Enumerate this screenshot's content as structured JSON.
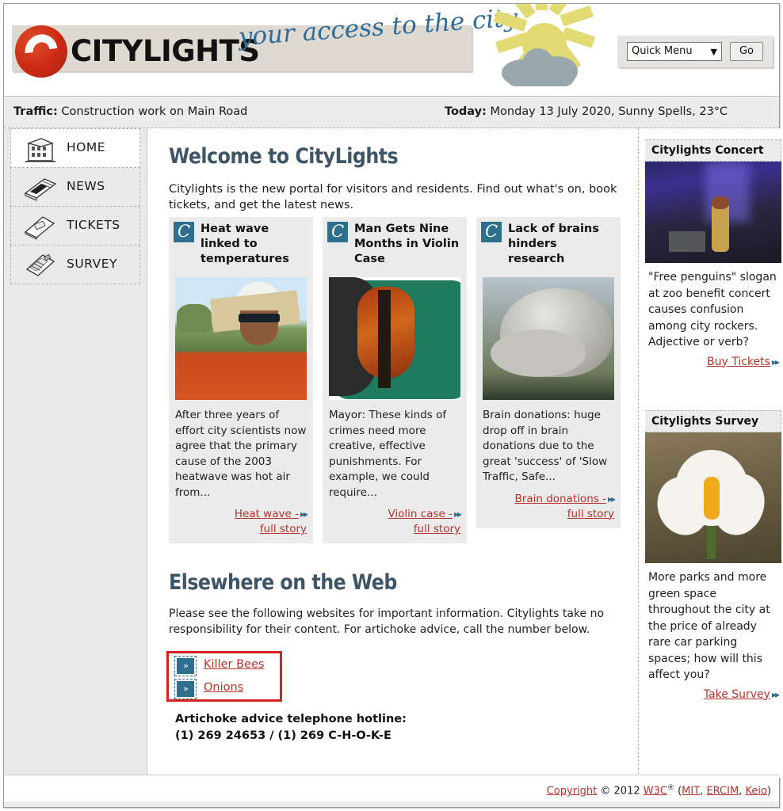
{
  "header": {
    "brand": "CITYLIGHTS",
    "tagline": "your access to the city",
    "quick_menu_value": "Quick Menu",
    "go_label": "Go",
    "logo_icon": "citylights-c-logo",
    "weather_icon": "sun-behind-cloud-icon"
  },
  "traffic_bar": {
    "traffic_label": "Traffic:",
    "traffic_text": "Construction work on Main Road",
    "today_label": "Today:",
    "today_text": "Monday 13 July 2020, Sunny Spells, 23°C"
  },
  "sidebar": {
    "items": [
      {
        "label": "HOME",
        "icon": "building-icon",
        "active": true
      },
      {
        "label": "NEWS",
        "icon": "newspaper-icon",
        "active": false
      },
      {
        "label": "TICKETS",
        "icon": "ticket-icon",
        "active": false
      },
      {
        "label": "SURVEY",
        "icon": "clipboard-icon",
        "active": false
      }
    ]
  },
  "main": {
    "welcome_title": "Welcome to CityLights",
    "intro": "Citylights is the new portal for visitors and residents. Find out what's on, book tickets, and get the latest news.",
    "cards": [
      {
        "badge": "C",
        "title": "Heat wave linked to temperatures",
        "image_alt": "man-wearing-cardboard-sun-hat-photo",
        "text": "After three years of effort city scientists now agree that the primary cause of the 2003 heatwave was hot air from...",
        "link_line1": "Heat wave -",
        "link_line2": "full story"
      },
      {
        "badge": "C",
        "title": "Man Gets Nine Months in Violin Case",
        "image_alt": "violin-in-green-case-photo",
        "text": "Mayor: These kinds of crimes need more creative, effective punishments. For example, we could require...",
        "link_line1": "Violin case -",
        "link_line2": "full story"
      },
      {
        "badge": "C",
        "title": "Lack of brains hinders research",
        "image_alt": "model-of-human-brain-photo",
        "text": "Brain donations: huge drop off in brain donations due to the great 'success' of 'Slow Traffic, Safe...",
        "link_line1": "Brain donations -",
        "link_line2": "full story"
      }
    ],
    "elsewhere_title": "Elsewhere on the Web",
    "elsewhere_text": "Please see the following websites for important information. Citylights take no responsibility for their content. For artichoke advice, call the number below.",
    "external_links": [
      {
        "label": "Killer Bees",
        "icon": "double-chevron-icon"
      },
      {
        "label": "Onions",
        "icon": "double-chevron-icon"
      }
    ],
    "hotline_label": "Artichoke advice telephone hotline:",
    "hotline_number": "(1) 269 24653 / (1) 269 C-H-O-K-E"
  },
  "right_panels": [
    {
      "title": "Citylights Concert",
      "image_alt": "singer-on-stage-with-blue-lights-photo",
      "text": "\"Free penguins\" slogan at zoo benefit concert causes confusion among city rockers. Adjective or verb?",
      "link": "Buy Tickets"
    },
    {
      "title": "Citylights Survey",
      "image_alt": "white-crocus-flower-photo",
      "text": "More parks and more green space throughout the city at the price of already rare car parking spaces; how will this affect you?",
      "link": "Take Survey"
    }
  ],
  "footer": {
    "copyright_link": "Copyright",
    "copyright_mid": "© 2012",
    "w3c_link": "W3C",
    "registered_mark": "®",
    "open_paren": "(",
    "mit_link": "MIT",
    "comma1": ",",
    "ercim_link": "ERCIM",
    "comma2": ",",
    "keio_link": "Keio",
    "close_paren": ")"
  },
  "colors": {
    "brand_red": "#cb2a15",
    "accent_teal": "#2e6f8e",
    "link_red": "#b5332a",
    "heading_slate": "#3e5565",
    "highlight_red": "#d32020",
    "sun_yellow": "#e2da73",
    "cloud_gray": "#9aa7ae"
  }
}
